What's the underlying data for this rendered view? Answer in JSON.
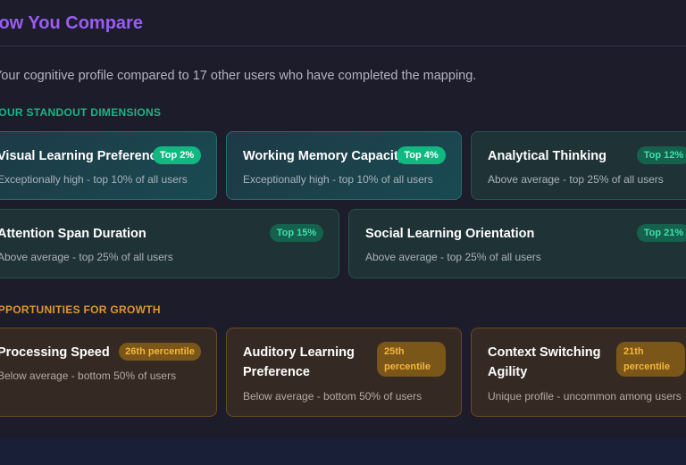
{
  "header": {
    "title": "How You Compare",
    "subtitle": "Your cognitive profile compared to 17 other users who have completed the mapping."
  },
  "standout": {
    "label": "YOUR STANDOUT DIMENSIONS",
    "cards": [
      {
        "title": "Visual Learning Preference",
        "badge": "Top 2%",
        "desc": "Exceptionally high - top 10% of all users"
      },
      {
        "title": "Working Memory Capacity",
        "badge": "Top 4%",
        "desc": "Exceptionally high - top 10% of all users"
      },
      {
        "title": "Analytical Thinking",
        "badge": "Top 12%",
        "desc": "Above average - top 25% of all users"
      },
      {
        "title": "Attention Span Duration",
        "badge": "Top 15%",
        "desc": "Above average - top 25% of all users"
      },
      {
        "title": "Social Learning Orientation",
        "badge": "Top 21%",
        "desc": "Above average - top 25% of all users"
      }
    ]
  },
  "growth": {
    "label": "OPPORTUNITIES FOR GROWTH",
    "cards": [
      {
        "title": "Processing Speed",
        "badge": "26th percentile",
        "desc": "Below average - bottom 50% of users"
      },
      {
        "title": "Auditory Learning Preference",
        "badge": "25th percentile",
        "desc": "Below average - bottom 50% of users"
      },
      {
        "title": "Context Switching Agility",
        "badge": "21th percentile",
        "desc": "Unique profile - uncommon among users"
      }
    ]
  },
  "colors": {
    "accent_purple": "#9b5cf6",
    "standout_green": "#1bb589",
    "growth_amber": "#e0962c",
    "background": "#1c1c2a"
  }
}
